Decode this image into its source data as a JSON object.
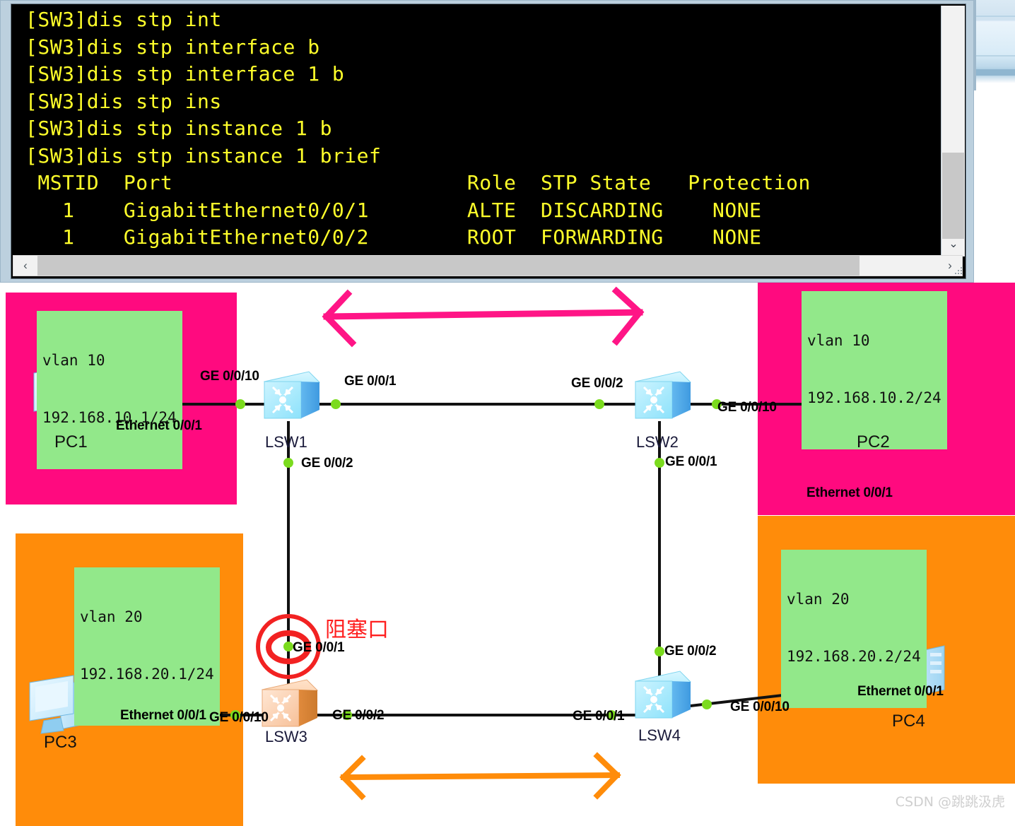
{
  "terminal": {
    "lines": [
      "[SW3]dis stp int",
      "[SW3]dis stp interface b",
      "[SW3]dis stp interface 1 b",
      "[SW3]dis stp ins",
      "[SW3]dis stp instance 1 b",
      "[SW3]dis stp instance 1 brief"
    ],
    "table_header": " MSTID  Port                        Role  STP State   Protection",
    "table_rows": [
      "   1    GigabitEthernet0/0/1        ALTE  DISCARDING    NONE",
      "   1    GigabitEthernet0/0/2        ROOT  FORWARDING    NONE"
    ],
    "prompt": "[SW3]",
    "columns": [
      "MSTID",
      "Port",
      "Role",
      "STP State",
      "Protection"
    ],
    "rows": [
      {
        "mstid": "1",
        "port": "GigabitEthernet0/0/1",
        "role": "ALTE",
        "state": "DISCARDING",
        "protection": "NONE"
      },
      {
        "mstid": "1",
        "port": "GigabitEthernet0/0/2",
        "role": "ROOT",
        "state": "FORWARDING",
        "protection": "NONE"
      }
    ],
    "scroll_left_arrow": "‹",
    "scroll_right_arrow": "›",
    "scroll_down_arrow": "⌄",
    "text_color": "#ffff2a",
    "bg_color": "#000000"
  },
  "diagram": {
    "zones": [
      {
        "id": "vlan10-left",
        "color": "#ff0a7f"
      },
      {
        "id": "vlan10-right",
        "color": "#ff0a7f"
      },
      {
        "id": "vlan20-left",
        "color": "#ff8c0a"
      },
      {
        "id": "vlan20-right",
        "color": "#ff8c0a"
      }
    ],
    "vlan_labels": [
      {
        "id": "vlan10-left",
        "line1": "vlan 10",
        "line2": "192.168.10.1/24"
      },
      {
        "id": "vlan10-right",
        "line1": "vlan 10",
        "line2": "192.168.10.2/24"
      },
      {
        "id": "vlan20-left",
        "line1": "vlan 20",
        "line2": "192.168.20.1/24"
      },
      {
        "id": "vlan20-right",
        "line1": "vlan 20",
        "line2": "192.168.20.2/24"
      }
    ],
    "hosts": [
      {
        "id": "pc1",
        "name": "PC1"
      },
      {
        "id": "pc2",
        "name": "PC2"
      },
      {
        "id": "pc3",
        "name": "PC3"
      },
      {
        "id": "pc4",
        "name": "PC4"
      }
    ],
    "switches": [
      {
        "id": "lsw1",
        "name": "LSW1",
        "color": "#9fe8fb"
      },
      {
        "id": "lsw2",
        "name": "LSW2",
        "color": "#9fe8fb"
      },
      {
        "id": "lsw3",
        "name": "LSW3",
        "color": "#f7c49a"
      },
      {
        "id": "lsw4",
        "name": "LSW4",
        "color": "#9fe8fb"
      }
    ],
    "port_labels": {
      "pc1_eth": "Ethernet 0/0/1",
      "lsw1_ge10": "GE 0/0/10",
      "lsw1_ge1": "GE 0/0/1",
      "lsw1_ge2": "GE 0/0/2",
      "lsw2_ge2": "GE 0/0/2",
      "lsw2_ge10": "GE 0/0/10",
      "lsw2_ge1": "GE 0/0/1",
      "pc2_eth": "Ethernet 0/0/1",
      "pc3_eth": "Ethernet 0/0/1",
      "lsw3_ge10": "GE 0/0/10",
      "lsw3_ge1": "GE 0/0/1",
      "lsw3_ge2": "GE 0/0/2",
      "lsw4_ge1": "GE 0/0/1",
      "lsw4_ge2": "GE 0/0/2",
      "lsw4_ge10": "GE 0/0/10",
      "pc4_eth": "Ethernet 0/0/1"
    },
    "annotation": {
      "blocked_port_text": "阻塞口",
      "blocked_color": "#ff1f1f",
      "arrow_top_color": "#ff1586",
      "arrow_bottom_color": "#ff8c0a"
    }
  },
  "watermark": "CSDN @跳跳汲虎"
}
